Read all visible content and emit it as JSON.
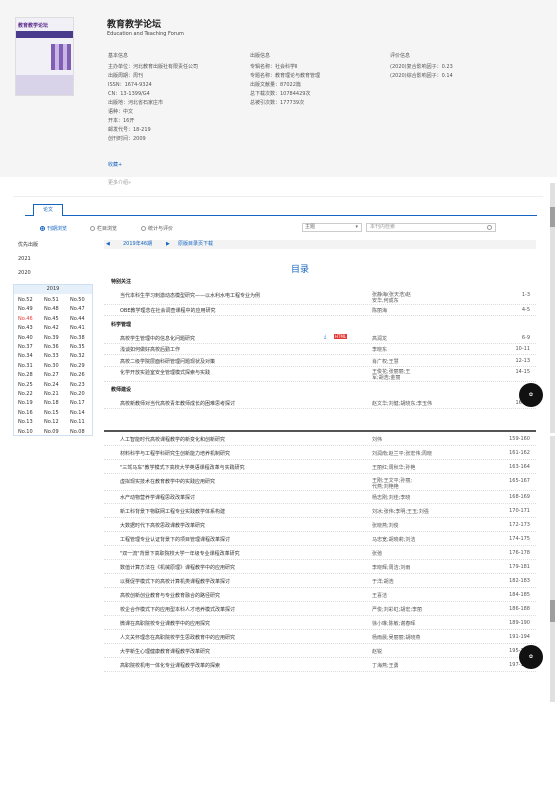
{
  "journal": {
    "cover_title": "教育教学论坛",
    "title": "教育教学论坛",
    "subtitle": "Education and Teaching Forum",
    "basic_header": "基本信息",
    "basic": [
      "主办单位：河北教育出版社有限责任公司",
      "出版周期：周刊",
      "ISSN：1674-9324",
      "CN：13-1399/G4",
      "出版地：河北省石家庄市",
      "语种：中文",
      "开本：16开",
      "邮发代号：18-219",
      "创刊时间：2009"
    ],
    "pub_header": "出版信息",
    "pub": [
      "专辑名称：社会科学Ⅱ",
      "专题名称：教育理论与教育管理",
      "出版文献量：87022篇",
      "总下载次数：10784429次",
      "总被引次数：177739次"
    ],
    "eval_header": "评价信息",
    "eval": [
      "(2020)复合影响因子：0.23",
      "(2020)综合影响因子：0.14"
    ],
    "favorite": "收藏+",
    "more": "更多介绍»"
  },
  "tabs": {
    "active": "论文"
  },
  "radios": [
    "刊期浏览",
    "栏目浏览",
    "统计与评价"
  ],
  "search": {
    "select": "主题",
    "placeholder": "本刊内检索"
  },
  "years": {
    "header": "优先出版",
    "list": [
      "2021",
      "2020"
    ],
    "current": "2019"
  },
  "issues": [
    [
      "No.52",
      "No.51",
      "No.50"
    ],
    [
      "No.49",
      "No.48",
      "No.47"
    ],
    [
      "No.46",
      "No.45",
      "No.44"
    ],
    [
      "No.43",
      "No.42",
      "No.41"
    ],
    [
      "No.40",
      "No.39",
      "No.38"
    ],
    [
      "No.37",
      "No.36",
      "No.35"
    ],
    [
      "No.34",
      "No.33",
      "No.32"
    ],
    [
      "No.31",
      "No.30",
      "No.29"
    ],
    [
      "No.28",
      "No.27",
      "No.26"
    ],
    [
      "No.25",
      "No.24",
      "No.23"
    ],
    [
      "No.22",
      "No.21",
      "No.20"
    ],
    [
      "No.19",
      "No.18",
      "No.17"
    ],
    [
      "No.16",
      "No.15",
      "No.14"
    ],
    [
      "No.13",
      "No.12",
      "No.11"
    ],
    [
      "No.10",
      "No.09",
      "No.08"
    ]
  ],
  "issue_nav": {
    "prev": "◀",
    "issue": "2019年46期",
    "next": "▶",
    "download": "原版目录页下载"
  },
  "toc": {
    "title": "目录",
    "sections": [
      {
        "name": "特别关注",
        "articles": [
          {
            "title": "当代本科生学习刺激动态模型研究——以水利水电工程专业为例",
            "authors": "张静海(张天浩)赵安华,何成东",
            "pages": "1-3"
          },
          {
            "title": "OBE教学理念在社会调查课程中的应用研究",
            "authors": "陈丽海",
            "pages": "4-5"
          }
        ]
      },
      {
        "name": "科学管理",
        "articles": [
          {
            "title": "高校学生管理中的信息化问题研究",
            "authors": "高润龙",
            "pages": "6-9"
          },
          {
            "title": "浅谈如何做好高校后勤工作",
            "authors": "李晓东",
            "pages": "10-11"
          },
          {
            "title": "高校二级学院层面科研管理问题现状及对策",
            "authors": "肖广权;王慧",
            "pages": "12-13"
          },
          {
            "title": "化学开放实验室安全管理模式探索与实践",
            "authors": "王俊花;张丽丽;王军;胡浩;金丽",
            "pages": "14-15"
          }
        ]
      },
      {
        "name": "教师建设",
        "articles": [
          {
            "title": "高校新教师对当代高校青年教师成长的困难思考探讨",
            "authors": "赵文华;刘健;胡晓东;李玉伟",
            "pages": "16-17"
          }
        ]
      }
    ]
  },
  "lower_toc": [
    {
      "title": "人工智能时代高校课程教学的新变化和创新研究",
      "authors": "刘伟",
      "pages": "159-160"
    },
    {
      "title": "材料科学与工程学科研究生创新能力培养机制研究",
      "authors": "刘润南;赵兰平;张宏伟;周晓",
      "pages": "161-162"
    },
    {
      "title": "\"三驾马车\"教学模式下高校大学英语课程改革与实践研究",
      "authors": "王丽红;周秋华;孙艳",
      "pages": "163-164"
    },
    {
      "title": "虚拟现实技术在教育教学中的实践应用研究",
      "authors": "王刚;王文平;孙丽;代燕;刘艳艳",
      "pages": "165-167"
    },
    {
      "title": "水产动物营养学课程思政改革探讨",
      "authors": "杨志刚;刘佳;李晓",
      "pages": "168-169"
    },
    {
      "title": "新工科背景下物联网工程专业实践教学体系构建",
      "authors": "刘冰;张伟;李明;王玉;刘强",
      "pages": "170-171"
    },
    {
      "title": "大数据时代下高校思政课教学改革研究",
      "authors": "张晓燕;刘俊",
      "pages": "172-173"
    },
    {
      "title": "工程管理专业认证背景下的项目管理课程改革探讨",
      "authors": "马忠宽;胡晓莉;刘洁",
      "pages": "174-175"
    },
    {
      "title": "\"双一流\"背景下高职院校大学一年级专业课程改革研究",
      "authors": "张弛",
      "pages": "176-178"
    },
    {
      "title": "数值计算方法在《机械原理》课程教学中的应用研究",
      "authors": "李晓辉;周洁;刘雨",
      "pages": "179-181"
    },
    {
      "title": "以赛促学模式下的高校计算机类课程教学改革探讨",
      "authors": "于洋;胡浩",
      "pages": "182-183"
    },
    {
      "title": "高校创新创业教育与专业教育融合的路径研究",
      "authors": "王喜洁",
      "pages": "184-185"
    },
    {
      "title": "校企合作模式下的应用型本科人才培养模式改革探讨",
      "authors": "严俊;刘彩虹;胡宏;李丽",
      "pages": "186-188"
    },
    {
      "title": "微课在高职院校专业课教学中的应用探究",
      "authors": "徐小琳;陈敏;谢春晖",
      "pages": "189-190"
    },
    {
      "title": "人文关怀理念在高职院校学生思政教育中的应用研究",
      "authors": "杨雨晨;吴丽丽;胡晓燕",
      "pages": "191-194"
    },
    {
      "title": "大学新生心理健康教育课程教学改革研究",
      "authors": "赵锐",
      "pages": "195-196"
    },
    {
      "title": "高职院校机电一体化专业课程教学改革的探索",
      "authors": "丁海燕;王勇",
      "pages": "197-198"
    }
  ],
  "icons": {
    "download": "download-icon",
    "html": "html-badge"
  },
  "colors": {
    "accent": "#1565c0",
    "active_issue": "#e53935"
  }
}
